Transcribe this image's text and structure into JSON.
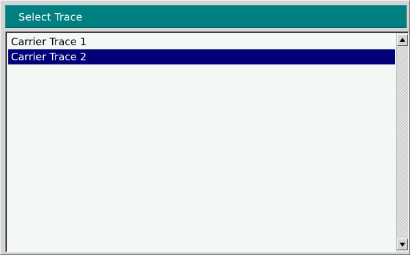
{
  "dialog": {
    "title": "Select Trace"
  },
  "list": {
    "items": [
      {
        "label": "Carrier Trace 1",
        "selected": false
      },
      {
        "label": "Carrier Trace 2",
        "selected": true
      }
    ]
  },
  "scrollbar": {
    "up_icon": "arrow-up-icon",
    "down_icon": "arrow-down-icon"
  },
  "colors": {
    "titlebar": "#008080",
    "selection": "#000078",
    "list_background": "#f4f8f4"
  }
}
